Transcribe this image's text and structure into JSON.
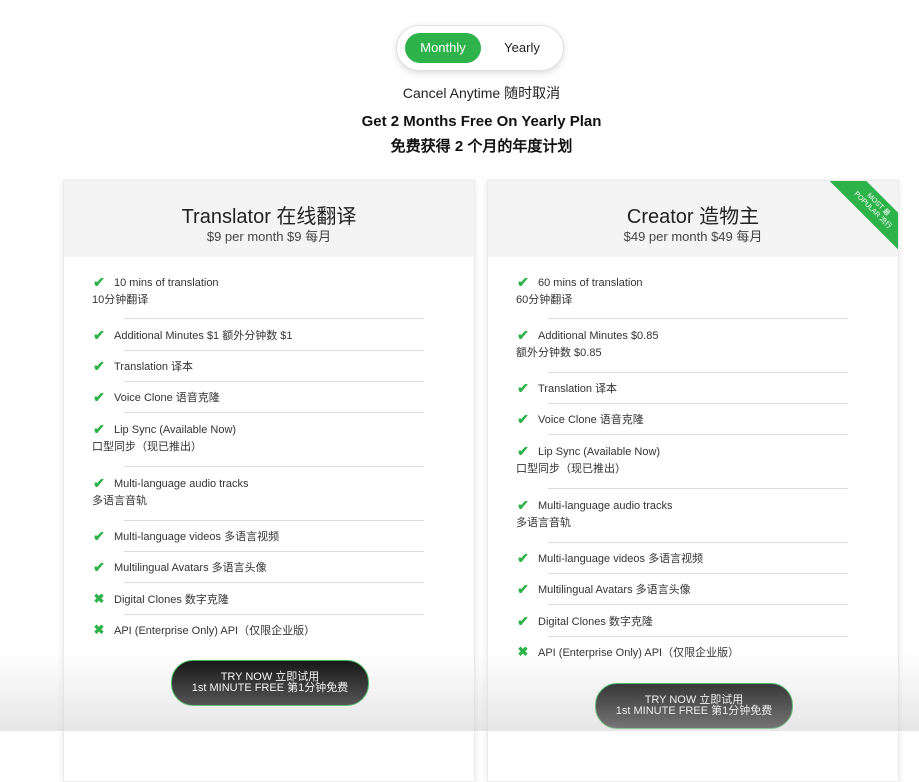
{
  "billing_toggle": {
    "monthly_label": "Monthly",
    "yearly_label": "Yearly",
    "selected": "Monthly"
  },
  "cancel_text": "Cancel Anytime 随时取消",
  "promo": {
    "line1": "Get 2 Months Free On Yearly Plan",
    "line2": "免费获得 2 个月的年度计划"
  },
  "colors": {
    "accent": "#2eb24a",
    "cta_bg": "#0b0b0b"
  },
  "plans": [
    {
      "name": "Translator  在线翻译",
      "price": "$9 per month  $9 每月",
      "features": [
        {
          "included": true,
          "line1": "10 mins of translation",
          "line2": "10分钟翻译"
        },
        {
          "included": true,
          "line1": "Additional Minutes $1  额外分钟数 $1",
          "line2": ""
        },
        {
          "included": true,
          "line1": "Translation  译本",
          "line2": ""
        },
        {
          "included": true,
          "line1": "Voice Clone  语音克隆",
          "line2": ""
        },
        {
          "included": true,
          "line1": "Lip Sync (Available Now)",
          "line2": "口型同步（现已推出）"
        },
        {
          "included": true,
          "line1": "Multi-language audio tracks",
          "line2": "多语言音轨"
        },
        {
          "included": true,
          "line1": "Multi-language videos  多语言视频",
          "line2": ""
        },
        {
          "included": true,
          "line1": "Multilingual Avatars  多语言头像",
          "line2": ""
        },
        {
          "included": false,
          "line1": "Digital Clones  数字克隆",
          "line2": ""
        },
        {
          "included": false,
          "line1": "API (Enterprise Only)  API（仅限企业版）",
          "line2": ""
        }
      ],
      "cta": {
        "line1": "TRY NOW  立即试用",
        "line2": "1st MINUTE FREE  第1分钟免费"
      }
    },
    {
      "name": "Creator  造物主",
      "price": "$49 per month  $49 每月",
      "ribbon": {
        "line1": "MOST  最",
        "line2": "POPULAR  流行"
      },
      "features": [
        {
          "included": true,
          "line1": "60 mins of translation",
          "line2": "60分钟翻译"
        },
        {
          "included": true,
          "line1": "Additional Minutes $0.85",
          "line2": "额外分钟数 $0.85"
        },
        {
          "included": true,
          "line1": "Translation  译本",
          "line2": ""
        },
        {
          "included": true,
          "line1": "Voice Clone  语音克隆",
          "line2": ""
        },
        {
          "included": true,
          "line1": "Lip Sync (Available Now)",
          "line2": "口型同步（现已推出）"
        },
        {
          "included": true,
          "line1": "Multi-language audio tracks",
          "line2": "多语言音轨"
        },
        {
          "included": true,
          "line1": "Multi-language videos  多语言视频",
          "line2": ""
        },
        {
          "included": true,
          "line1": "Multilingual Avatars  多语言头像",
          "line2": ""
        },
        {
          "included": true,
          "line1": "Digital Clones  数字克隆",
          "line2": ""
        },
        {
          "included": false,
          "line1": "API (Enterprise Only)  API（仅限企业版）",
          "line2": ""
        }
      ],
      "cta": {
        "line1": "TRY NOW  立即试用",
        "line2": "1st MINUTE FREE  第1分钟免费"
      }
    }
  ]
}
